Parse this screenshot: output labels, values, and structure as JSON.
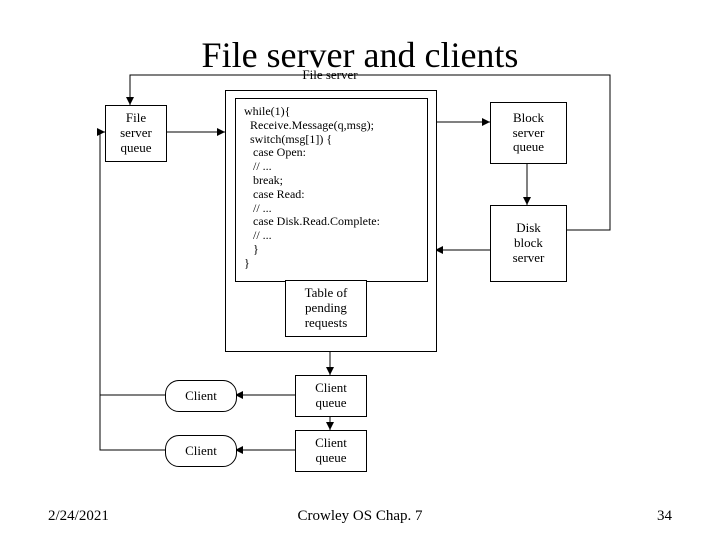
{
  "title": "File server and clients",
  "date": "2/24/2021",
  "footer_center": "Crowley    OS    Chap. 7",
  "page_number": "34",
  "diagram": {
    "file_server_caption": "File server",
    "file_server_queue": "File\nserver\nqueue",
    "block_server_queue": "Block\nserver\nqueue",
    "disk_block_server": "Disk\nblock\nserver",
    "pending_table": "Table of\npending\nrequests",
    "client1": "Client",
    "client2": "Client",
    "client_queue1": "Client\nqueue",
    "client_queue2": "Client\nqueue",
    "code": "while(1){\n  Receive.Message(q,msg);\n  switch(msg[1]) {\n   case Open:\n   // ...\n   break;\n   case Read:\n   // ...\n   case Disk.Read.Complete:\n   // ...\n   }\n}"
  }
}
